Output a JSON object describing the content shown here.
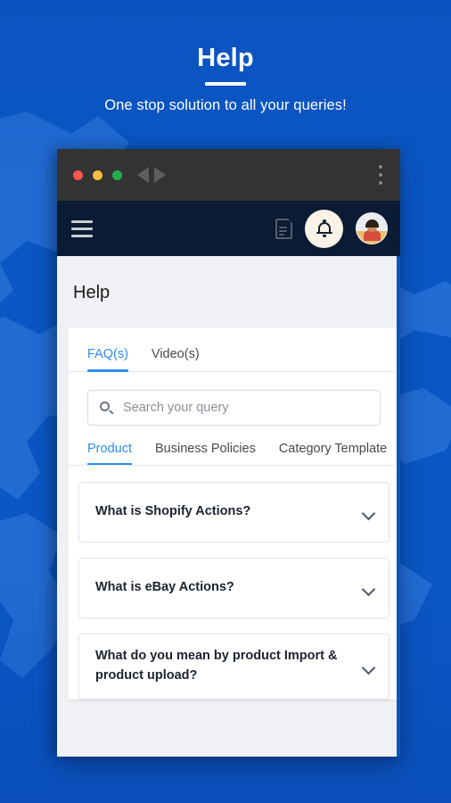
{
  "hero": {
    "title": "Help",
    "subtitle": "One stop solution to all your queries!"
  },
  "browser_chrome": {
    "close_label": "",
    "minimize_label": "",
    "maximize_label": "",
    "back_label": "",
    "forward_label": "",
    "menu_label": "",
    "colors": {
      "close": "#F9564F",
      "minimize": "#F6BE3E",
      "maximize": "#20B14C",
      "bar": "#333333"
    }
  },
  "appbar": {
    "menu_icon": "hamburger-icon",
    "doc_icon": "document-icon",
    "bell_icon": "bell-icon",
    "avatar_icon": "user-avatar",
    "background": "#0B1B33",
    "bell_circle_color": "#FAF2E7"
  },
  "page": {
    "title": "Help",
    "background": "#EFF1F4"
  },
  "tabs": {
    "accent": "#2C8DF0",
    "items": [
      {
        "label": "FAQ(s)",
        "active": true
      },
      {
        "label": "Video(s)",
        "active": false
      }
    ]
  },
  "search": {
    "icon": "search-icon",
    "value": "",
    "placeholder": "Search your query"
  },
  "categories": {
    "items": [
      {
        "label": "Product",
        "active": true
      },
      {
        "label": "Business Policies",
        "active": false
      },
      {
        "label": "Category Template",
        "active": false
      }
    ]
  },
  "faqs": {
    "expand_icon": "chevron-down-icon",
    "items": [
      {
        "question": "What is Shopify Actions?"
      },
      {
        "question": "What is eBay Actions?"
      },
      {
        "question": "What do you mean by product Import & product upload?"
      }
    ]
  }
}
